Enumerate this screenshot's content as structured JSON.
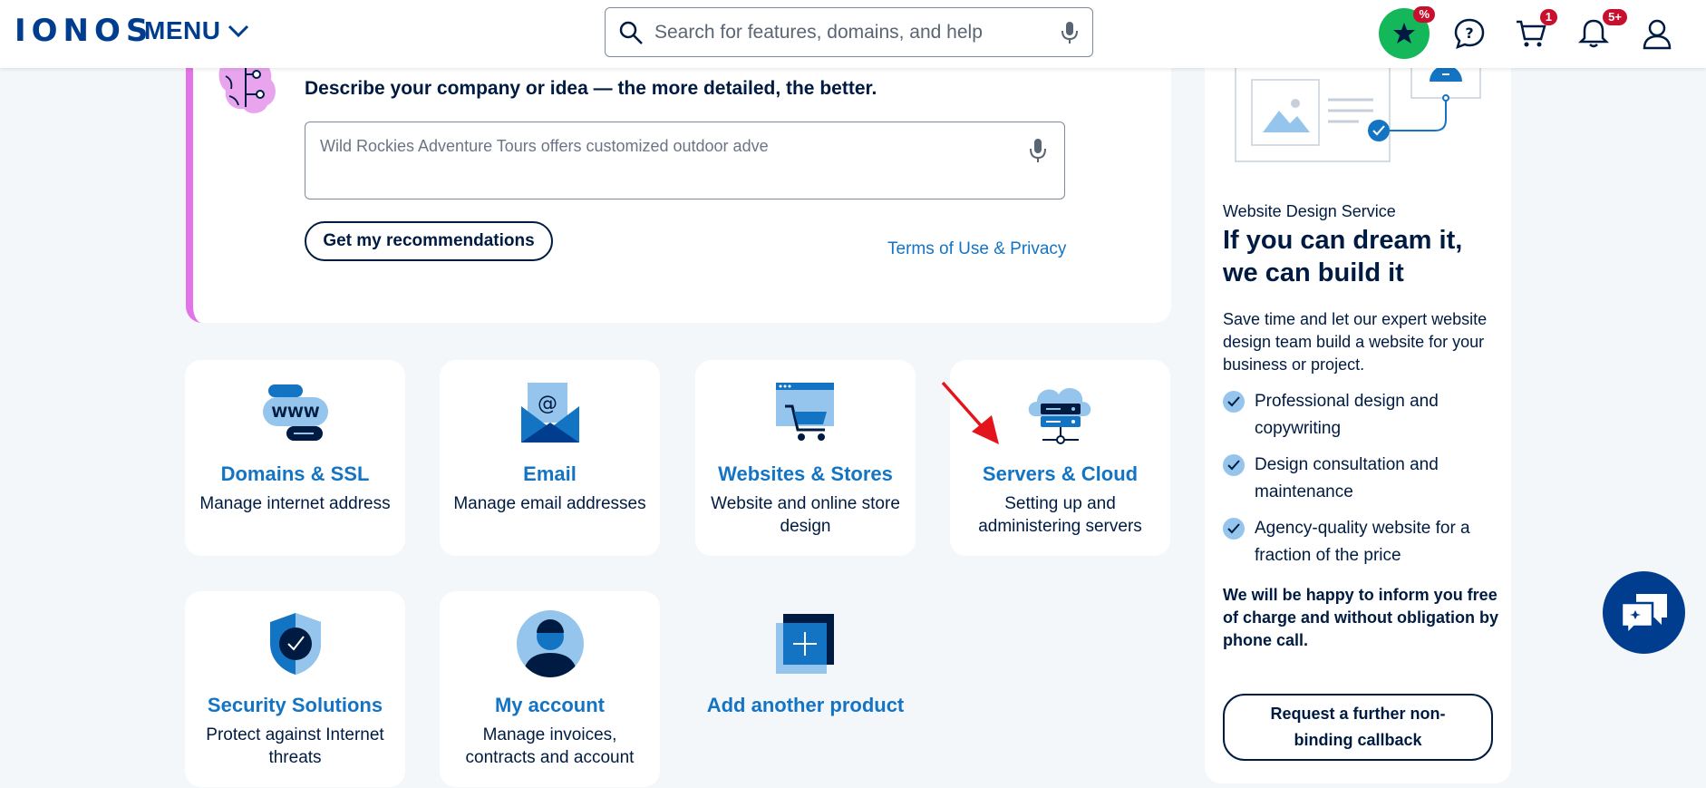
{
  "header": {
    "logo": "IONOS",
    "menu_label": "MENU",
    "search_placeholder": "Search for features, domains, and help",
    "promo_badge": "%",
    "cart_badge": "1",
    "notifications_badge": "5+"
  },
  "ai": {
    "heading": "Describe your company or idea — the more detailed, the better.",
    "input_value": "Wild Rockies Adventure Tours offers customized outdoor adve",
    "button_label": "Get my recommendations",
    "terms_link": "Terms of Use & Privacy"
  },
  "products": [
    {
      "title": "Domains & SSL",
      "desc": "Manage internet address"
    },
    {
      "title": "Email",
      "desc": "Manage email addresses"
    },
    {
      "title": "Websites & Stores",
      "desc": "Website and online store design"
    },
    {
      "title": "Servers & Cloud",
      "desc": "Setting up and administering servers"
    },
    {
      "title": "Security Solutions",
      "desc": "Protect against Internet threats"
    },
    {
      "title": "My account",
      "desc": "Manage invoices, contracts and account"
    },
    {
      "title": "Add another product",
      "desc": ""
    }
  ],
  "sidebar": {
    "eyebrow": "Website Design Service",
    "title": "If you can dream it, we can build it",
    "body": "Save time and let our expert website design team build a website for your business or project.",
    "features": [
      "Professional design and copywriting",
      "Design consultation and maintenance",
      "Agency-quality website for a fraction of the price"
    ],
    "strong_text": "We will be happy to inform you free of charge and without obligation by phone call.",
    "callback_button": "Request a further non-binding callback"
  },
  "colors": {
    "brand": "#003d8f",
    "link": "#1474c4",
    "accent_pink": "#e373e8",
    "badge_red": "#c8102e",
    "promo_green": "#14b85a"
  }
}
